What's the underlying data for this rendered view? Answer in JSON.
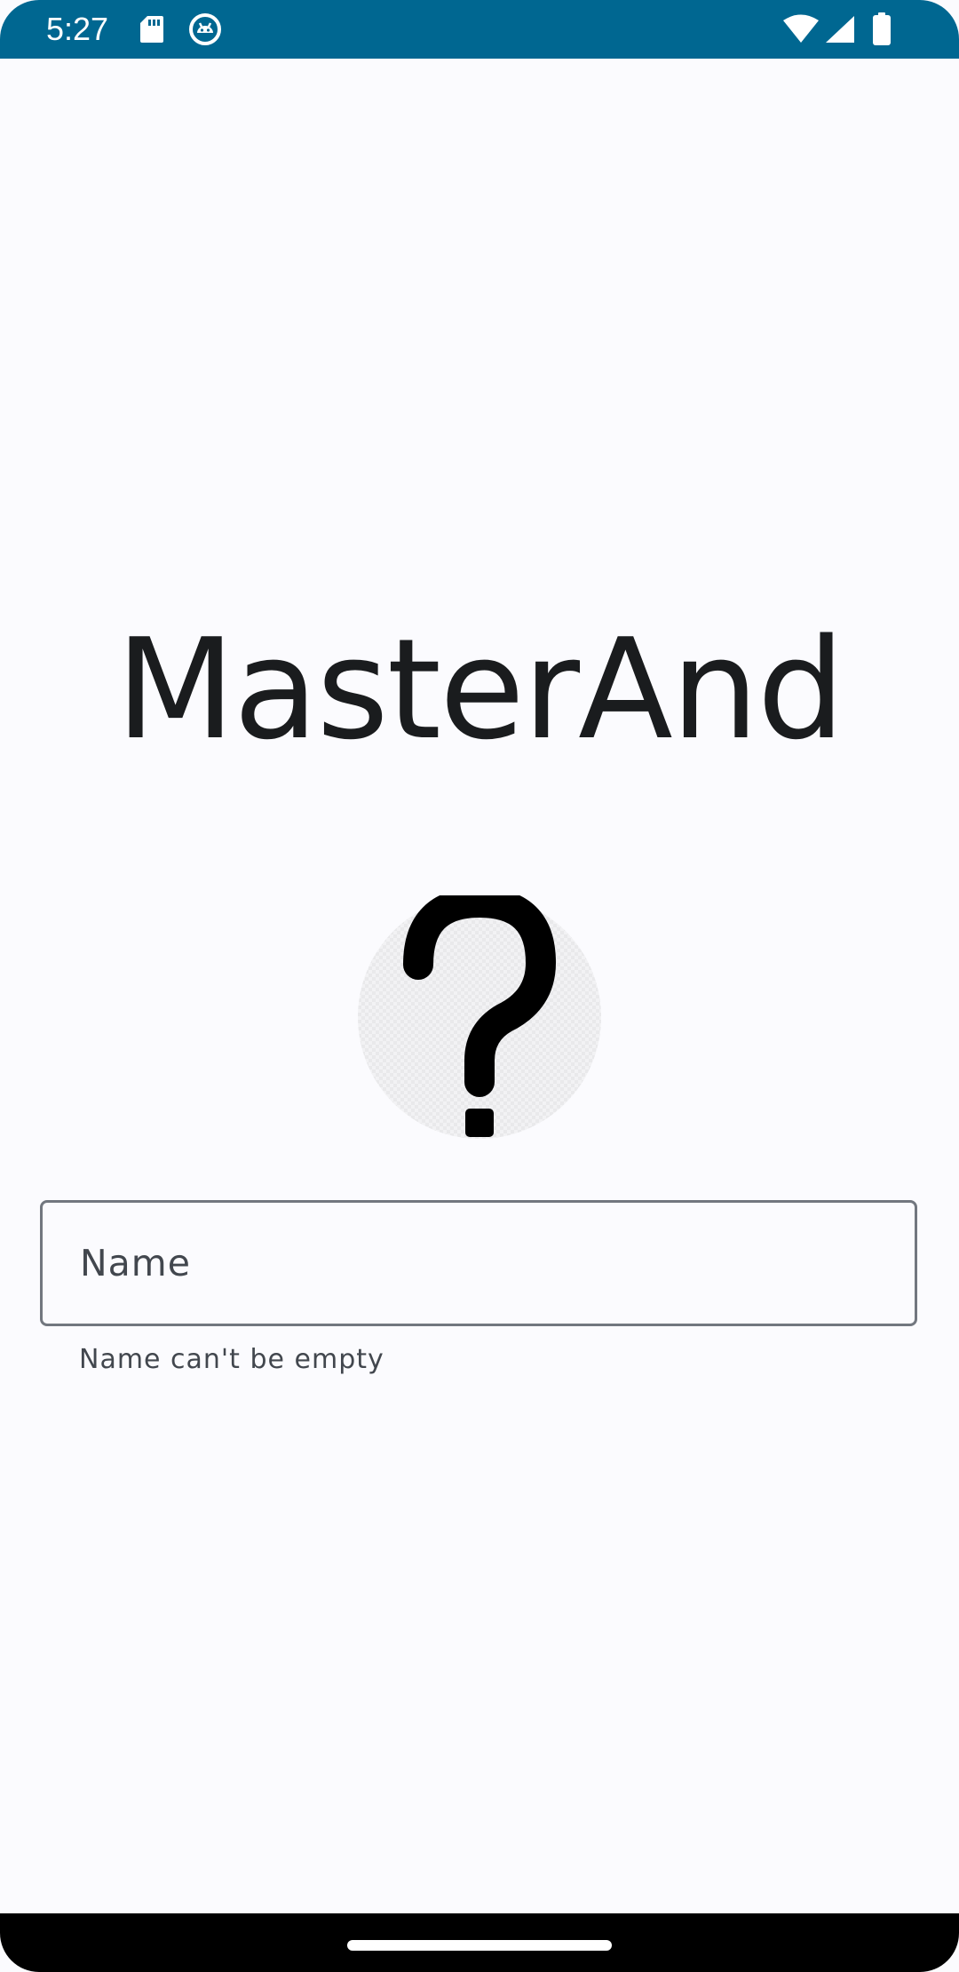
{
  "status_bar": {
    "time": "5:27",
    "left_icons": [
      "sd-card-icon",
      "android-debug-icon"
    ],
    "right_icons": [
      "wifi-icon",
      "cell-signal-icon",
      "battery-icon"
    ],
    "background": "#006791"
  },
  "main": {
    "title": "MasterAnd",
    "avatar_icon": "question-mark-icon",
    "name_field": {
      "placeholder": "Name",
      "value": ""
    },
    "name_supporting_text": "Name can't be empty"
  },
  "colors": {
    "background": "#fbfbfe",
    "title_text": "#1a1c1e",
    "field_outline": "#72777f",
    "field_text": "#42474e"
  }
}
